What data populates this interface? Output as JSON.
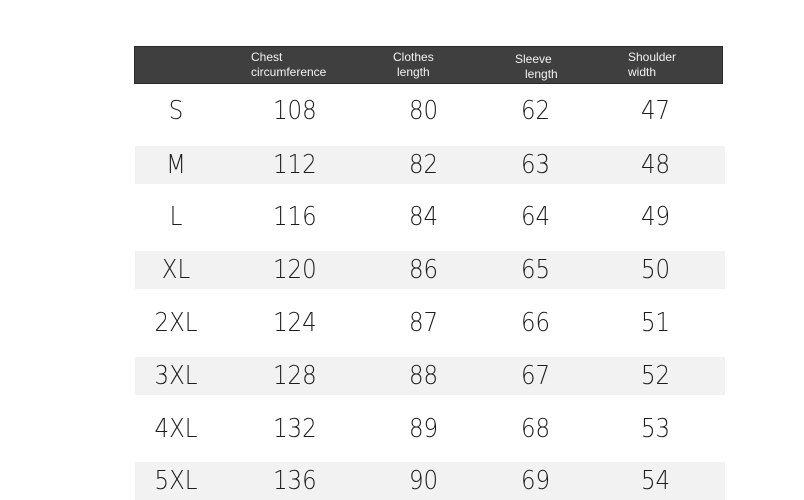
{
  "table": {
    "headers": [
      "",
      "Chest\ncircumference",
      "Clothes\nlength",
      "Sleeve\nlength",
      "Shoulder\nwidth"
    ],
    "header_lines": [
      [
        "",
        ""
      ],
      [
        "Chest",
        "circumference"
      ],
      [
        "Clothes",
        "length"
      ],
      [
        "Sleeve",
        "length"
      ],
      [
        "Shoulder",
        "width"
      ]
    ],
    "rows": [
      [
        "S",
        "108",
        "80",
        "62",
        "47"
      ],
      [
        "M",
        "112",
        "82",
        "63",
        "48"
      ],
      [
        "L",
        "116",
        "84",
        "64",
        "49"
      ],
      [
        "XL",
        "120",
        "86",
        "65",
        "50"
      ],
      [
        "2XL",
        "124",
        "87",
        "66",
        "51"
      ],
      [
        "3XL",
        "128",
        "88",
        "67",
        "52"
      ],
      [
        "4XL",
        "132",
        "89",
        "68",
        "53"
      ],
      [
        "5XL",
        "136",
        "90",
        "69",
        "54"
      ]
    ],
    "colors": {
      "header_bg": "#3f3f3f",
      "header_text": "#f2f2f2",
      "stripe": "#f2f2f2",
      "text": "#1c1c1c"
    }
  }
}
